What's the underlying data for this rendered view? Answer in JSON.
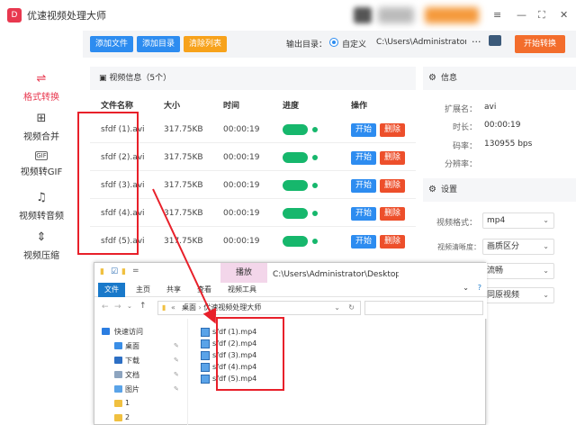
{
  "app": {
    "title": "优速视频处理大师",
    "logo_glyph": "D"
  },
  "window_controls": [
    "≡",
    "—",
    "⛶",
    "✕"
  ],
  "sidebar": {
    "items": [
      {
        "label": "格式转换",
        "icon": "⇌",
        "active": true
      },
      {
        "label": "视频合并",
        "icon": "⊞"
      },
      {
        "label": "视频转GIF",
        "icon": "GIF"
      },
      {
        "label": "视频转音频",
        "icon": "♫"
      },
      {
        "label": "视频压缩",
        "icon": "⇕"
      }
    ]
  },
  "toolbar": {
    "add_file": "添加文件",
    "add_dir": "添加目录",
    "clear_list": "清除列表",
    "output_label": "输出目录：",
    "custom_label": "自定义",
    "output_path": "C:\\Users\\Administrator\\",
    "more": "···",
    "start_convert": "开始转换"
  },
  "file_panel": {
    "header": "视频信息（5个）",
    "columns": [
      "文件名称",
      "大小",
      "时间",
      "进度",
      "操作"
    ],
    "rows": [
      {
        "name": "sfdf (1).avi",
        "size": "317.75KB",
        "time": "00:00:19",
        "progress": 1.0
      },
      {
        "name": "sfdf (2).avi",
        "size": "317.75KB",
        "time": "00:00:19",
        "progress": 1.0
      },
      {
        "name": "sfdf (3).avi",
        "size": "317.75KB",
        "time": "00:00:19",
        "progress": 1.0
      },
      {
        "name": "sfdf (4).avi",
        "size": "317.75KB",
        "time": "00:00:19",
        "progress": 1.0
      },
      {
        "name": "sfdf (5).avi",
        "size": "317.75KB",
        "time": "00:00:19",
        "progress": 1.0
      }
    ],
    "start_label": "开始",
    "delete_label": "删除"
  },
  "info_panel": {
    "header": "信息",
    "fields": [
      {
        "label": "扩展名：",
        "value": "avi"
      },
      {
        "label": "时长：",
        "value": "00:00:19"
      },
      {
        "label": "码率：",
        "value": "130955 bps"
      },
      {
        "label": "分辨率：",
        "value": ""
      }
    ]
  },
  "settings_panel": {
    "header": "设置",
    "fields": [
      {
        "label": "视频格式：",
        "value": "mp4"
      },
      {
        "label": "视频清晰度：",
        "value": "画质区分"
      },
      {
        "label": "",
        "value": "流畅"
      },
      {
        "label": "",
        "value": "同原视频"
      }
    ]
  },
  "explorer": {
    "play_tab": "播放",
    "title_path": "C:\\Users\\Administrator\\Desktop\\优...",
    "ribbon": {
      "file": "文件",
      "home": "主页",
      "share": "共享",
      "view": "查看",
      "video_tools": "视频工具"
    },
    "address": {
      "crumb1": "桌面",
      "crumb2": "优速视频处理大师"
    },
    "nav": [
      {
        "label": "快速访问",
        "color": "#2b7de1"
      },
      {
        "label": "桌面",
        "color": "#3a8ee6"
      },
      {
        "label": "下载",
        "color": "#2d6fc4"
      },
      {
        "label": "文档",
        "color": "#8da4bf"
      },
      {
        "label": "图片",
        "color": "#5aa3e8"
      },
      {
        "label": "1",
        "color": "#f0c040"
      },
      {
        "label": "2",
        "color": "#f0c040"
      }
    ],
    "files": [
      "sfdf (1).mp4",
      "sfdf (2).mp4",
      "sfdf (3).mp4",
      "sfdf (4).mp4",
      "sfdf (5).mp4"
    ]
  },
  "colors": {
    "accent_red": "#e8384f",
    "primary_blue": "#2d8cf0",
    "start_orange": "#f36d2c",
    "progress_green": "#16b76c",
    "delete_red": "#ed4f2b",
    "annotation_red": "#e8202a"
  }
}
